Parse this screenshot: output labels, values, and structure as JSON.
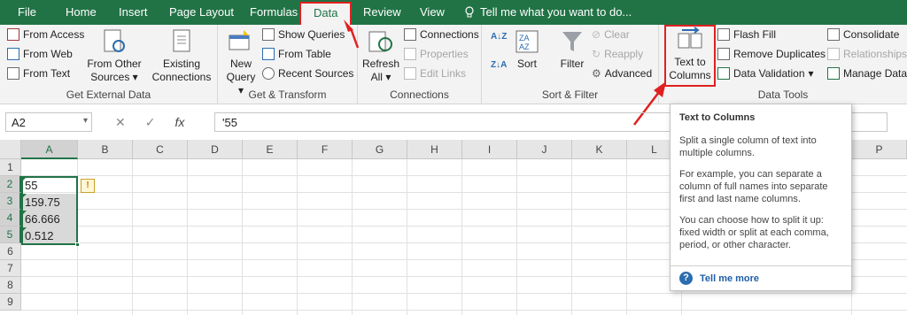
{
  "tabs": {
    "file": "File",
    "home": "Home",
    "insert": "Insert",
    "page_layout": "Page Layout",
    "formulas": "Formulas",
    "data": "Data",
    "review": "Review",
    "view": "View",
    "tell_me": "Tell me what you want to do..."
  },
  "ribbon": {
    "get_external": {
      "label": "Get External Data",
      "from_access": "From Access",
      "from_web": "From Web",
      "from_text": "From Text",
      "from_other_1": "From Other",
      "from_other_2": "Sources",
      "existing_1": "Existing",
      "existing_2": "Connections"
    },
    "get_transform": {
      "label": "Get & Transform",
      "new_query_1": "New",
      "new_query_2": "Query",
      "show_queries": "Show Queries",
      "from_table": "From Table",
      "recent_sources": "Recent Sources"
    },
    "connections": {
      "label": "Connections",
      "refresh_1": "Refresh",
      "refresh_2": "All",
      "connections": "Connections",
      "properties": "Properties",
      "edit_links": "Edit Links"
    },
    "sort_filter": {
      "label": "Sort & Filter",
      "sort": "Sort",
      "filter": "Filter",
      "clear": "Clear",
      "reapply": "Reapply",
      "advanced": "Advanced"
    },
    "data_tools": {
      "label": "Data Tools",
      "text_to_columns_1": "Text to",
      "text_to_columns_2": "Columns",
      "flash_fill": "Flash Fill",
      "remove_duplicates": "Remove Duplicates",
      "data_validation": "Data Validation",
      "consolidate": "Consolidate",
      "relationships": "Relationships",
      "manage_data": "Manage Data"
    }
  },
  "formula_bar": {
    "name_box": "A2",
    "fx": "fx",
    "formula": "'55"
  },
  "grid": {
    "columns": [
      "A",
      "B",
      "C",
      "D",
      "E",
      "F",
      "G",
      "H",
      "I",
      "J",
      "K",
      "L",
      "P"
    ],
    "rows": [
      "1",
      "2",
      "3",
      "4",
      "5",
      "6",
      "7",
      "8",
      "9"
    ],
    "cells": [
      "55",
      "159.75",
      "66.666",
      "0.512"
    ]
  },
  "tooltip": {
    "title": "Text to Columns",
    "p1": "Split a single column of text into multiple columns.",
    "p2": "For example, you can separate a column of full names into separate first and last name columns.",
    "p3": "You can choose how to split it up: fixed width or split at each comma, period, or other character.",
    "more": "Tell me more"
  },
  "colors": {
    "accent": "#217346",
    "highlight": "#e02020",
    "link": "#1f5fa8"
  }
}
